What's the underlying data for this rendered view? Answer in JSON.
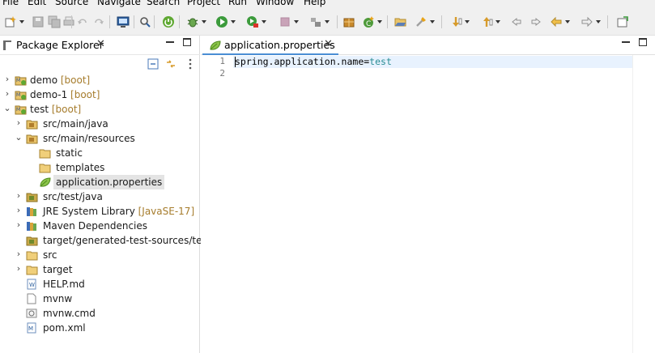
{
  "menubar": {
    "items": [
      "File",
      "Edit",
      "Source",
      "Navigate",
      "Search",
      "Project",
      "Run",
      "Window",
      "Help"
    ]
  },
  "toolbar": {
    "buttons": [
      "new-wizard-icon",
      "save-icon",
      "save-all-icon",
      "undo-icon",
      "redo-icon",
      "terminal-icon",
      "search-icon",
      "spring-boot-dashboard-icon",
      "debug-icon",
      "run-icon",
      "run-external-icon",
      "stop-icon",
      "build-icon",
      "open-type-icon",
      "new-java-class-icon",
      "open-folder-icon",
      "run-last-icon",
      "next-annotation-icon",
      "previous-annotation-icon",
      "last-edit-icon",
      "back-icon",
      "forward-icon",
      "pin-icon"
    ]
  },
  "package_explorer": {
    "title": "Package Explorer",
    "close_glyph": "✕",
    "tree": [
      {
        "label": "demo",
        "deco": " [boot]",
        "depth": 0,
        "expanded": false,
        "icon": "maven-boot-project-icon"
      },
      {
        "label": "demo-1",
        "deco": " [boot]",
        "depth": 0,
        "expanded": false,
        "icon": "maven-boot-project-icon"
      },
      {
        "label": "test",
        "deco": " [boot]",
        "depth": 0,
        "expanded": true,
        "icon": "maven-boot-project-icon"
      },
      {
        "label": "src/main/java",
        "deco": "",
        "depth": 1,
        "expanded": false,
        "icon": "source-folder-icon"
      },
      {
        "label": "src/main/resources",
        "deco": "",
        "depth": 1,
        "expanded": true,
        "icon": "source-folder-icon"
      },
      {
        "label": "static",
        "deco": "",
        "depth": 2,
        "expanded": null,
        "icon": "folder-icon"
      },
      {
        "label": "templates",
        "deco": "",
        "depth": 2,
        "expanded": null,
        "icon": "folder-icon"
      },
      {
        "label": "application.properties",
        "deco": "",
        "depth": 2,
        "expanded": null,
        "icon": "properties-file-icon",
        "selected": true
      },
      {
        "label": "src/test/java",
        "deco": "",
        "depth": 1,
        "expanded": false,
        "icon": "source-folder-icon"
      },
      {
        "label": "JRE System Library",
        "deco": " [JavaSE-17]",
        "depth": 1,
        "expanded": false,
        "icon": "library-icon"
      },
      {
        "label": "Maven Dependencies",
        "deco": "",
        "depth": 1,
        "expanded": false,
        "icon": "library-icon"
      },
      {
        "label": "target/generated-test-sources/test-a",
        "deco": "",
        "depth": 1,
        "expanded": null,
        "icon": "source-folder-icon"
      },
      {
        "label": "src",
        "deco": "",
        "depth": 1,
        "expanded": false,
        "icon": "folder-icon"
      },
      {
        "label": "target",
        "deco": "",
        "depth": 1,
        "expanded": false,
        "icon": "folder-icon"
      },
      {
        "label": "HELP.md",
        "deco": "",
        "depth": 1,
        "expanded": null,
        "icon": "markdown-file-icon"
      },
      {
        "label": "mvnw",
        "deco": "",
        "depth": 1,
        "expanded": null,
        "icon": "file-icon"
      },
      {
        "label": "mvnw.cmd",
        "deco": "",
        "depth": 1,
        "expanded": null,
        "icon": "cmd-file-icon"
      },
      {
        "label": "pom.xml",
        "deco": "",
        "depth": 1,
        "expanded": null,
        "icon": "maven-pom-icon"
      }
    ]
  },
  "editor": {
    "tab_label": "application.properties",
    "close_glyph": "✕",
    "line_numbers": [
      "1",
      "2"
    ],
    "lines": [
      {
        "key": "spring.application.name=",
        "value": "test"
      },
      {
        "key": "",
        "value": ""
      }
    ]
  },
  "colors": {
    "folder": "#e8c36a",
    "accent": "#4a8ed4",
    "property_value": "#2a8d95",
    "boot_deco": "#a67c2c"
  }
}
